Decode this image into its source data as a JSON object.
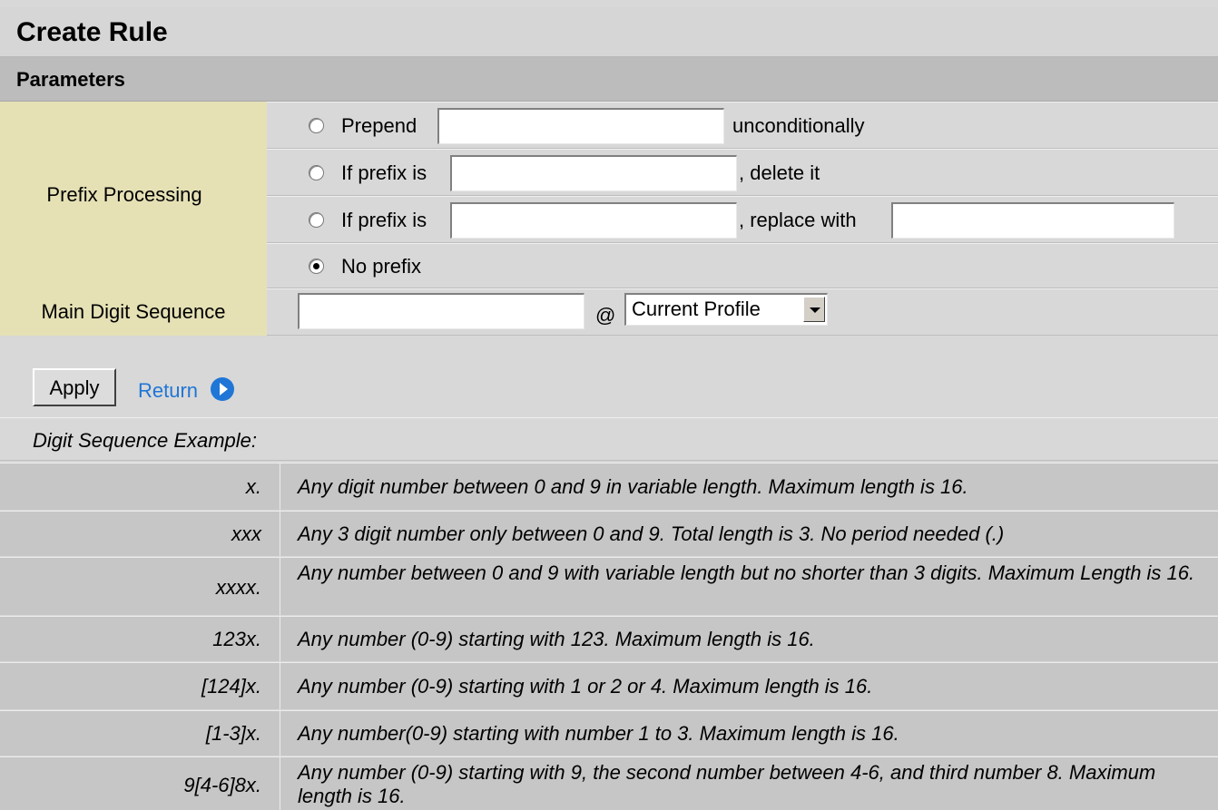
{
  "title": "Create Rule",
  "section": "Parameters",
  "prefix_processing": {
    "label": "Prefix Processing",
    "options": [
      {
        "label": "Prepend",
        "suffix": "unconditionally",
        "checked": false
      },
      {
        "label": "If prefix is",
        "suffix": ", delete it",
        "checked": false
      },
      {
        "label": "If prefix is",
        "suffix": ", replace with",
        "checked": false
      },
      {
        "label": "No prefix",
        "checked": true
      }
    ]
  },
  "main_digit_sequence": {
    "label": "Main Digit Sequence",
    "at": "@",
    "profile_selected": "Current Profile"
  },
  "buttons": {
    "apply": "Apply",
    "return": "Return"
  },
  "examples": {
    "title": "Digit Sequence Example:",
    "rows": [
      {
        "key": "x.",
        "desc": "Any digit number between 0 and 9 in variable length. Maximum length is 16."
      },
      {
        "key": "xxx",
        "desc": "Any 3 digit number only between 0 and 9. Total length is 3. No period needed (.)"
      },
      {
        "key": "xxxx.",
        "desc": "Any number between 0 and 9 with variable length but no shorter than 3 digits. Maximum Length is 16."
      },
      {
        "key": "123x.",
        "desc": "Any number (0-9) starting with 123. Maximum length is 16."
      },
      {
        "key": "[124]x.",
        "desc": "Any number (0-9) starting with 1 or 2 or 4. Maximum length is 16."
      },
      {
        "key": "[1-3]x.",
        "desc": "Any number(0-9) starting with number 1 to 3. Maximum length is 16."
      },
      {
        "key": "9[4-6]8x.",
        "desc": "Any number (0-9) starting with 9, the second number between 4-6, and third number 8. Maximum length is 16."
      }
    ]
  }
}
